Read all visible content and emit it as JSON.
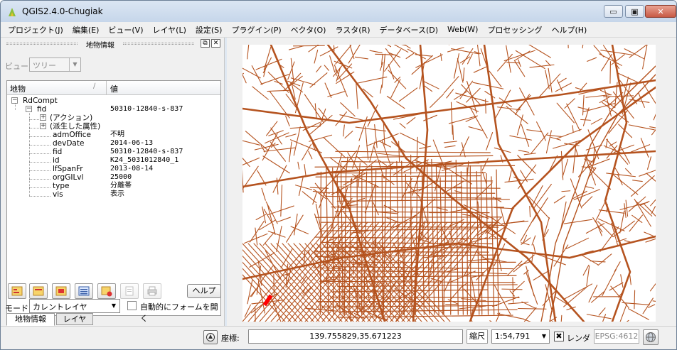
{
  "window": {
    "title": "QGIS2.4.0-Chugiak",
    "minimize_glyph": "▭",
    "maximize_glyph": "▣",
    "close_glyph": "✕"
  },
  "menubar": {
    "items": [
      "プロジェクト(J)",
      "編集(E)",
      "ビュー(V)",
      "レイヤ(L)",
      "設定(S)",
      "プラグイン(P)",
      "ベクタ(O)",
      "ラスタ(R)",
      "データベース(D)",
      "Web(W)",
      "プロセッシング",
      "ヘルプ(H)"
    ]
  },
  "panel": {
    "title": "地物情報",
    "float_glyph": "⧉",
    "close_glyph": "✕",
    "view_label": "ビュー",
    "view_value": "ツリー",
    "tree": {
      "col_feature": "地物",
      "col_value": "値",
      "root": "RdCompt",
      "fid_key": "fid",
      "fid_value": "50310-12840-s-837",
      "actions": "(アクション)",
      "derived": "(派生した属性)",
      "attributes": [
        {
          "key": "admOffice",
          "value": "不明"
        },
        {
          "key": "devDate",
          "value": "2014-06-13"
        },
        {
          "key": "fid",
          "value": "50310-12840-s-837"
        },
        {
          "key": "id",
          "value": "K24_5031012840_1"
        },
        {
          "key": "lfSpanFr",
          "value": "2013-08-14"
        },
        {
          "key": "orgGILvl",
          "value": "25000"
        },
        {
          "key": "type",
          "value": "分離帯"
        },
        {
          "key": "vis",
          "value": "表示"
        }
      ]
    },
    "help_button": "ヘルプ",
    "mode_label": "モード",
    "mode_value": "カレントレイヤ",
    "auto_open_label": "自動的にフォームを開く",
    "tabs": [
      "地物情報",
      "レイヤ"
    ]
  },
  "statusbar": {
    "coord_label": "座標:",
    "coord_value": "139.755829,35.671223",
    "scale_label": "縮尺",
    "scale_value": "1:54,791",
    "render_label": "レンダ",
    "render_check": "✖",
    "epsg": "EPSG:4612"
  },
  "colors": {
    "road": "#b5531f",
    "selected": "#ff0000"
  }
}
